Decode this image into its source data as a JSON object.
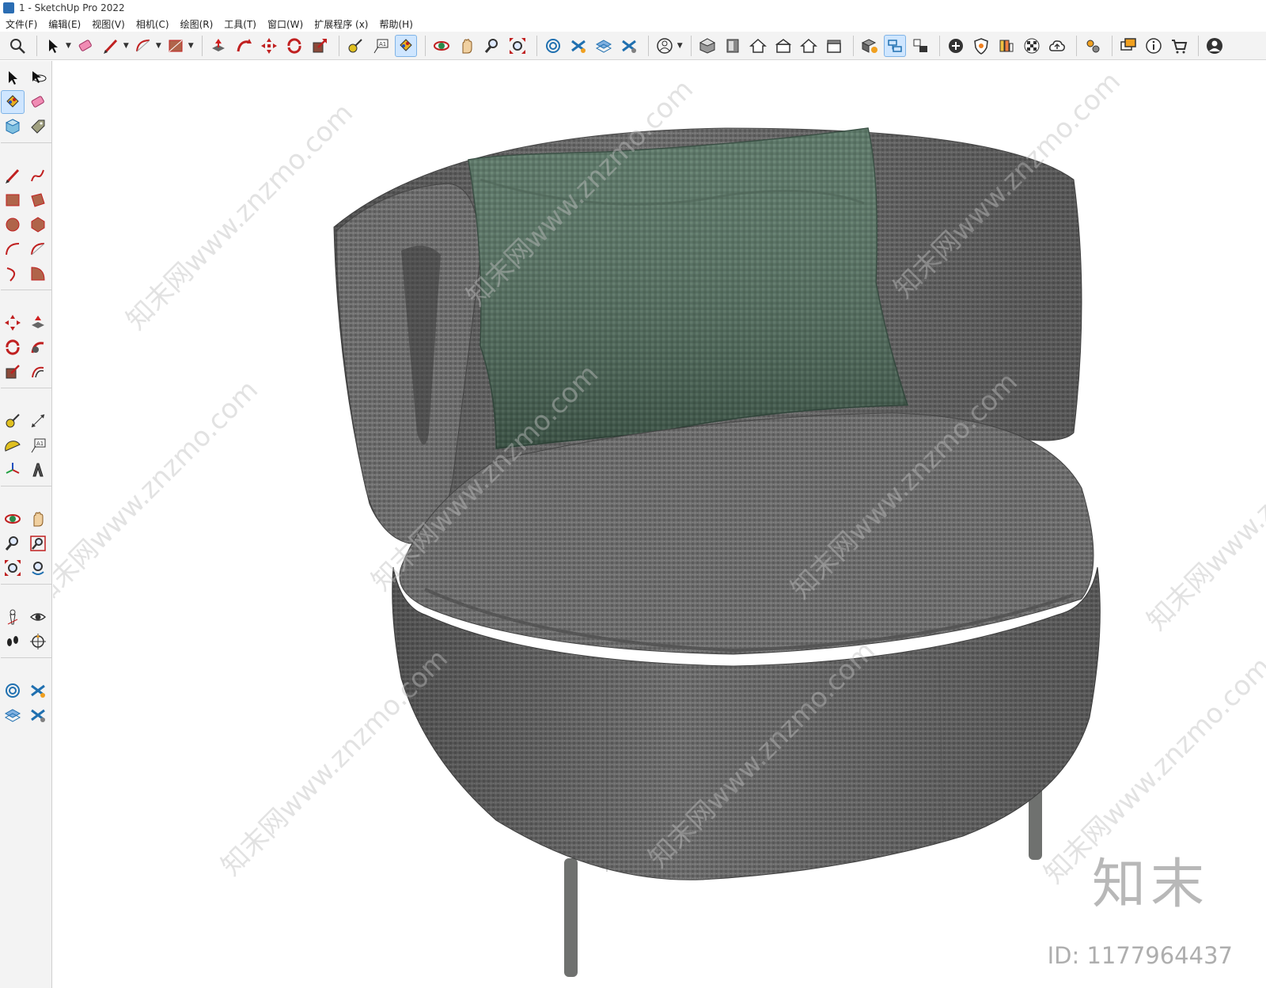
{
  "window": {
    "title": "1 - SketchUp Pro 2022"
  },
  "menu": [
    {
      "label": "文件(F)"
    },
    {
      "label": "编辑(E)"
    },
    {
      "label": "视图(V)"
    },
    {
      "label": "相机(C)"
    },
    {
      "label": "绘图(R)"
    },
    {
      "label": "工具(T)"
    },
    {
      "label": "窗口(W)"
    },
    {
      "label": "扩展程序 (x)"
    },
    {
      "label": "帮助(H)"
    }
  ],
  "toolbar": {
    "icons": [
      "zoom-icon",
      "select-icon",
      "eraser-icon",
      "pencil-icon",
      "arc-icon",
      "rectangle-icon",
      "push-pull-icon",
      "follow-me-icon",
      "move-icon",
      "rotate-icon",
      "scale-icon",
      "tape-measure-icon",
      "text-icon",
      "paint-bucket-icon",
      "orbit-icon",
      "pan-icon",
      "zoom-tool-icon",
      "zoom-extents-icon",
      "sandbox-icon",
      "section-icon",
      "layers-icon",
      "section-display-icon",
      "user-icon",
      "iso-view-icon",
      "front-view-icon",
      "top-view-icon",
      "right-view-icon",
      "back-view-icon",
      "left-view-icon",
      "components-icon",
      "styles-icon",
      "scenes-icon",
      "add-icon",
      "solid-tools-icon",
      "materials-icon",
      "texture-icon",
      "cloud-upload-icon",
      "extensions-icon",
      "message-icon",
      "info-icon",
      "cart-icon",
      "account-icon"
    ]
  },
  "sidebar": {
    "icons": [
      "select-icon",
      "orbit-icon",
      "paint-bucket-icon",
      "eraser-icon",
      "component-icon",
      "tag-icon",
      "pencil-icon",
      "freehand-icon",
      "rectangle-icon",
      "rotated-rectangle-icon",
      "circle-icon",
      "polygon-icon",
      "arc-icon",
      "2-point-arc-icon",
      "3-point-arc-icon",
      "pie-icon",
      "move-icon",
      "push-pull-icon",
      "rotate-icon",
      "follow-me-icon",
      "scale-icon",
      "offset-icon",
      "tape-measure-icon",
      "dimension-icon",
      "protractor-icon",
      "text-icon",
      "axes-icon",
      "3d-text-icon",
      "orbit-tool-icon",
      "pan-icon",
      "zoom-icon",
      "zoom-window-icon",
      "zoom-extents-icon",
      "previous-view-icon",
      "position-camera-icon",
      "look-around-icon",
      "walk-icon",
      "section-plane-icon",
      "sandbox-icon",
      "sandbox-scratch-icon",
      "layers-icon",
      "section-fill-icon"
    ]
  },
  "viewport": {
    "model": "gray fabric lounge chair with green pillow",
    "watermark_text": "知末网www.znzmo.com",
    "logo_text": "知末",
    "id_text": "ID: 1177964437"
  }
}
